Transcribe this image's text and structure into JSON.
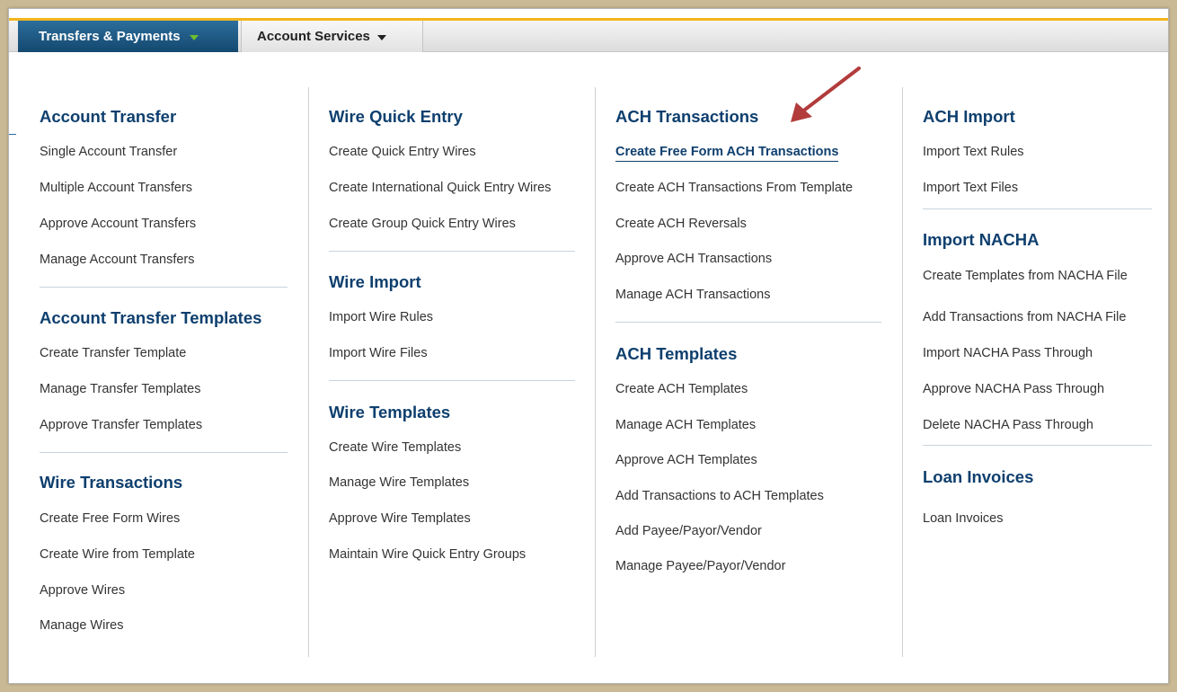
{
  "tabs": [
    {
      "label": "Transfers & Payments"
    },
    {
      "label": "Account Services"
    }
  ],
  "columns": [
    {
      "sections": [
        {
          "title": "Account Transfer",
          "items": [
            "Single Account Transfer",
            "Multiple Account Transfers",
            "Approve Account Transfers",
            "Manage Account Transfers"
          ]
        },
        {
          "title": "Account Transfer Templates",
          "items": [
            "Create Transfer Template",
            "Manage Transfer Templates",
            "Approve Transfer Templates"
          ]
        },
        {
          "title": "Wire Transactions",
          "items": [
            "Create Free Form Wires",
            "Create Wire from Template",
            "Approve Wires",
            "Manage Wires"
          ]
        }
      ]
    },
    {
      "sections": [
        {
          "title": "Wire Quick Entry",
          "items": [
            "Create Quick Entry Wires",
            "Create International Quick Entry Wires",
            "Create Group Quick Entry Wires"
          ]
        },
        {
          "title": "Wire Import",
          "items": [
            "Import Wire Rules",
            "Import Wire Files"
          ]
        },
        {
          "title": "Wire Templates",
          "items": [
            "Create Wire Templates",
            "Manage Wire Templates",
            "Approve Wire Templates",
            "Maintain Wire Quick Entry Groups"
          ]
        }
      ]
    },
    {
      "sections": [
        {
          "title": "ACH Transactions",
          "items": [
            "Create Free Form ACH Transactions",
            "Create ACH Transactions From Template",
            "Create ACH Reversals",
            "Approve ACH Transactions",
            "Manage ACH Transactions"
          ]
        },
        {
          "title": "ACH Templates",
          "items": [
            "Create ACH Templates",
            "Manage ACH Templates",
            "Approve ACH Templates",
            "Add Transactions to ACH Templates",
            "Add Payee/Payor/Vendor",
            "Manage Payee/Payor/Vendor"
          ]
        }
      ]
    },
    {
      "sections": [
        {
          "title": "ACH Import",
          "items": [
            "Import Text Rules",
            "Import Text Files"
          ]
        },
        {
          "title": "Import NACHA",
          "items": [
            "Create Templates from NACHA File",
            "Add Transactions from NACHA File",
            "Import NACHA Pass Through",
            "Approve NACHA Pass Through",
            "Delete NACHA Pass Through"
          ]
        },
        {
          "title": "Loan Invoices",
          "items": [
            "Loan Invoices"
          ]
        }
      ]
    }
  ],
  "colors": {
    "accent_line": "#f2b51c",
    "active_tab": "#1f5a86",
    "heading": "#0e3f6e",
    "annotation_arrow": "#b23b3b"
  }
}
